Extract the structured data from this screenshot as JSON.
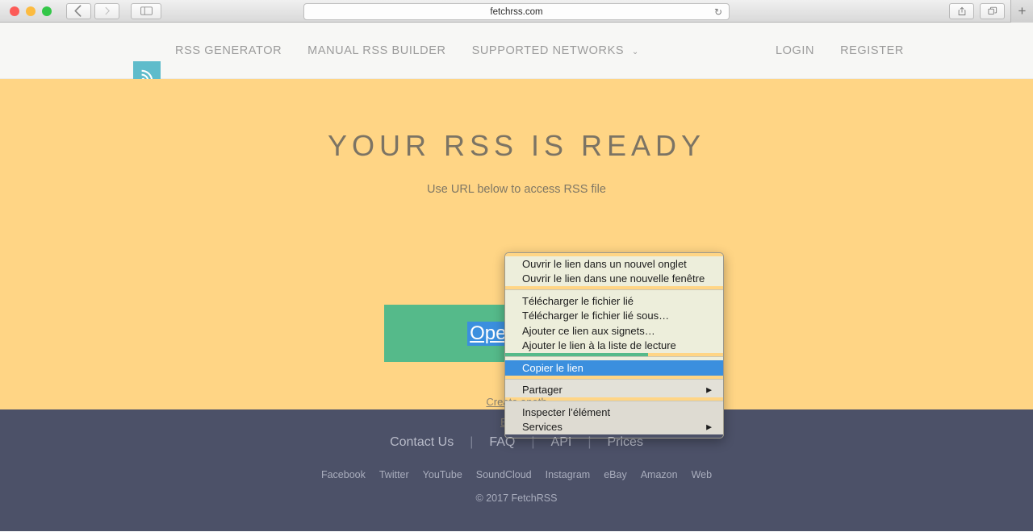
{
  "browser": {
    "url": "fetchrss.com",
    "back_icon": "chevron-left-icon",
    "forward_icon": "chevron-right-icon",
    "sidebar_icon": "sidebar-icon",
    "reload_icon": "reload-icon",
    "share_icon": "share-icon",
    "tabs_icon": "tabs-icon",
    "new_tab_label": "+"
  },
  "header": {
    "logo_icon": "rss-icon",
    "logo_bg": "#5fbccb",
    "nav": [
      {
        "label": "RSS GENERATOR"
      },
      {
        "label": "MANUAL RSS BUILDER"
      },
      {
        "label": "SUPPORTED NETWORKS",
        "caret": "⌄"
      }
    ],
    "auth": [
      {
        "label": "LOGIN"
      },
      {
        "label": "REGISTER"
      }
    ]
  },
  "hero": {
    "bg": "#ffd585",
    "title": "YOUR RSS IS READY",
    "subtitle": "Use URL below to access RSS file",
    "button_label": "Open RSS",
    "button_bg": "#55ba8a",
    "selection_color": "#3b8fde",
    "links": [
      {
        "label": "Create anoth"
      },
      {
        "label": "Build a"
      }
    ]
  },
  "context_menu": {
    "bg": "#edeedb",
    "highlight": "#3b8fde",
    "sections": [
      {
        "tint": "",
        "items": [
          {
            "label": "Ouvrir le lien dans un nouvel onglet",
            "selected": false,
            "submenu": false
          },
          {
            "label": "Ouvrir le lien dans une nouvelle fenêtre",
            "selected": false,
            "submenu": false
          }
        ]
      },
      {
        "tint": "",
        "items": [
          {
            "label": "Télécharger le fichier lié",
            "selected": false,
            "submenu": false
          },
          {
            "label": "Télécharger le fichier lié sous…",
            "selected": false,
            "submenu": false
          },
          {
            "label": "Ajouter ce lien aux signets…",
            "selected": false,
            "submenu": false
          },
          {
            "label": "Ajouter le lien à la liste de lecture",
            "selected": false,
            "submenu": false
          }
        ]
      },
      {
        "tint": "",
        "items": [
          {
            "label": "Copier le lien",
            "selected": true,
            "submenu": false
          }
        ]
      },
      {
        "tint": "gray",
        "items": [
          {
            "label": "Partager",
            "selected": false,
            "submenu": true,
            "arrow": "▶"
          }
        ]
      },
      {
        "tint": "gray2",
        "items": [
          {
            "label": "Inspecter l’élément",
            "selected": false,
            "submenu": false
          },
          {
            "label": "Services",
            "selected": false,
            "submenu": true,
            "arrow": "▶"
          }
        ]
      }
    ]
  },
  "footer": {
    "bg": "#4c5168",
    "primary_links": [
      {
        "label": "Contact Us"
      },
      {
        "label": "FAQ"
      },
      {
        "label": "API"
      },
      {
        "label": "Prices"
      }
    ],
    "separator": "|",
    "networks": [
      {
        "label": "Facebook"
      },
      {
        "label": "Twitter"
      },
      {
        "label": "YouTube"
      },
      {
        "label": "SoundCloud"
      },
      {
        "label": "Instagram"
      },
      {
        "label": "eBay"
      },
      {
        "label": "Amazon"
      },
      {
        "label": "Web"
      }
    ],
    "copyright": "© 2017 FetchRSS"
  }
}
